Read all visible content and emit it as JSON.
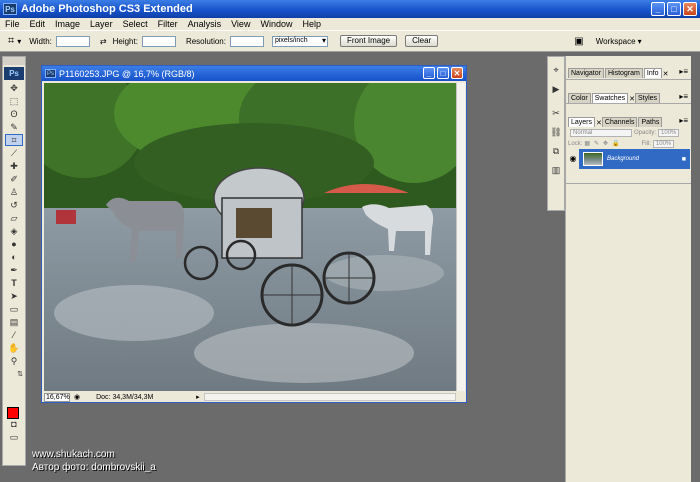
{
  "app": {
    "title": "Adobe Photoshop CS3 Extended",
    "icon_text": "Ps"
  },
  "menu": [
    "File",
    "Edit",
    "Image",
    "Layer",
    "Select",
    "Filter",
    "Analysis",
    "View",
    "Window",
    "Help"
  ],
  "options_bar": {
    "width_label": "Width:",
    "height_label": "Height:",
    "resolution_label": "Resolution:",
    "resolution_unit": "pixels/inch",
    "front_image_label": "Front Image",
    "clear_label": "Clear",
    "workspace_label": "Workspace"
  },
  "toolbox": {
    "logo": "Ps",
    "foreground_color": "#ff0000",
    "background_color": "#ffffff"
  },
  "document": {
    "title": "P1160253.JPG @ 16,7% (RGB/8)",
    "zoom": "16,67%",
    "doc_size": "Doc: 34,3M/34,3M"
  },
  "panels": {
    "group1": [
      "Navigator",
      "Histogram",
      "Info"
    ],
    "group2": [
      "Color",
      "Swatches",
      "Styles"
    ],
    "group3": [
      "Layers",
      "Channels",
      "Paths"
    ],
    "blend_mode": "Normal",
    "opacity_label": "Opacity:",
    "opacity_value": "100%",
    "lock_label": "Lock:",
    "fill_label": "Fill:",
    "fill_value": "100%",
    "layer_name": "Background"
  },
  "watermark": {
    "line1": "www.shukach.com",
    "line2": "Автор фото: dombrovskii_a"
  }
}
